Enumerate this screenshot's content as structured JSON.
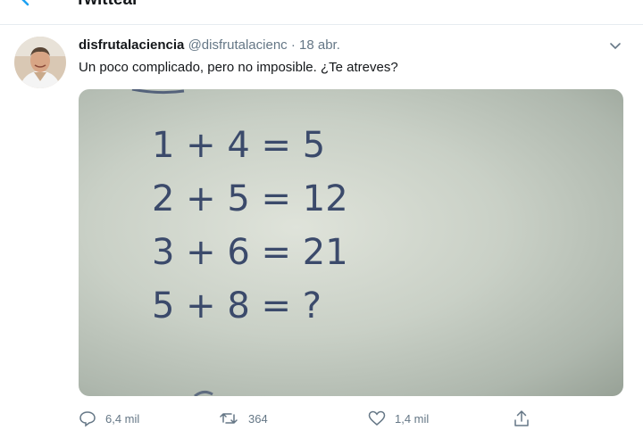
{
  "header": {
    "title": "Twittear"
  },
  "tweet": {
    "author": "disfrutalaciencia",
    "handle": "@disfrutalacienc",
    "separator": "·",
    "date": "18 abr.",
    "text": "Un poco complicado, pero no imposible. ¿Te atreves?"
  },
  "image": {
    "lines": [
      "1 + 4 = 5",
      "2 + 5 = 12",
      "3 + 6 = 21",
      "5 + 8 = ?"
    ]
  },
  "actions": {
    "replies": "6,4 mil",
    "retweets": "364",
    "likes": "1,4 mil"
  },
  "colors": {
    "accent": "#1da1f2",
    "text": "#14171a",
    "secondary": "#657786",
    "ink": "#3b4a6b"
  },
  "icons": {
    "back": "arrow-left-icon",
    "menu": "chevron-down-icon",
    "reply": "comment-icon",
    "retweet": "retweet-icon",
    "like": "heart-icon",
    "share": "share-icon"
  }
}
